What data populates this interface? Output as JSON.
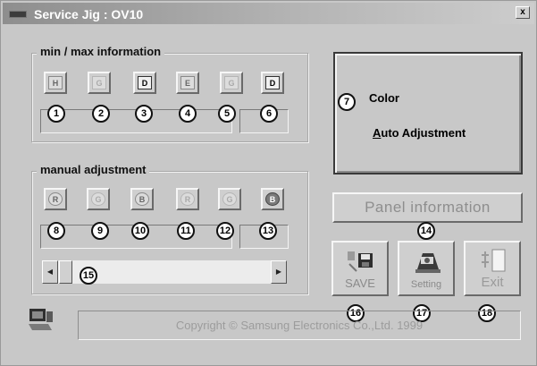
{
  "window": {
    "title": "Service Jig : OV10",
    "close_label": "x"
  },
  "minmax": {
    "title": "min / max information",
    "buttons": [
      "H",
      "G",
      "D",
      "E",
      "G",
      "D"
    ],
    "markers": [
      "1",
      "2",
      "3",
      "4",
      "5",
      "6"
    ]
  },
  "manual": {
    "title": "manual adjustment",
    "buttons": [
      "R",
      "G",
      "B",
      "R",
      "G",
      "B"
    ],
    "markers": [
      "8",
      "9",
      "10",
      "11",
      "12",
      "13"
    ],
    "scroll_marker": "15",
    "scroll_left": "◀",
    "scroll_right": "▶"
  },
  "color_panel": {
    "marker": "7",
    "label": "Color",
    "auto_first": "A",
    "auto_rest": "uto Adjustment"
  },
  "panel_info": {
    "label": "Panel information",
    "marker": "14"
  },
  "actions": {
    "save_label": "SAVE",
    "setting_label": "Setting",
    "exit_label": "Exit",
    "save_marker": "16",
    "setting_marker": "17",
    "exit_marker": "18"
  },
  "footer": {
    "copyright": "Copyright © Samsung Electronics Co.,Ltd. 1999"
  },
  "icons": {
    "app": "computer-icon",
    "save": "floppy-disk-icon",
    "setting": "gear-icon",
    "exit": "exit-door-icon"
  }
}
